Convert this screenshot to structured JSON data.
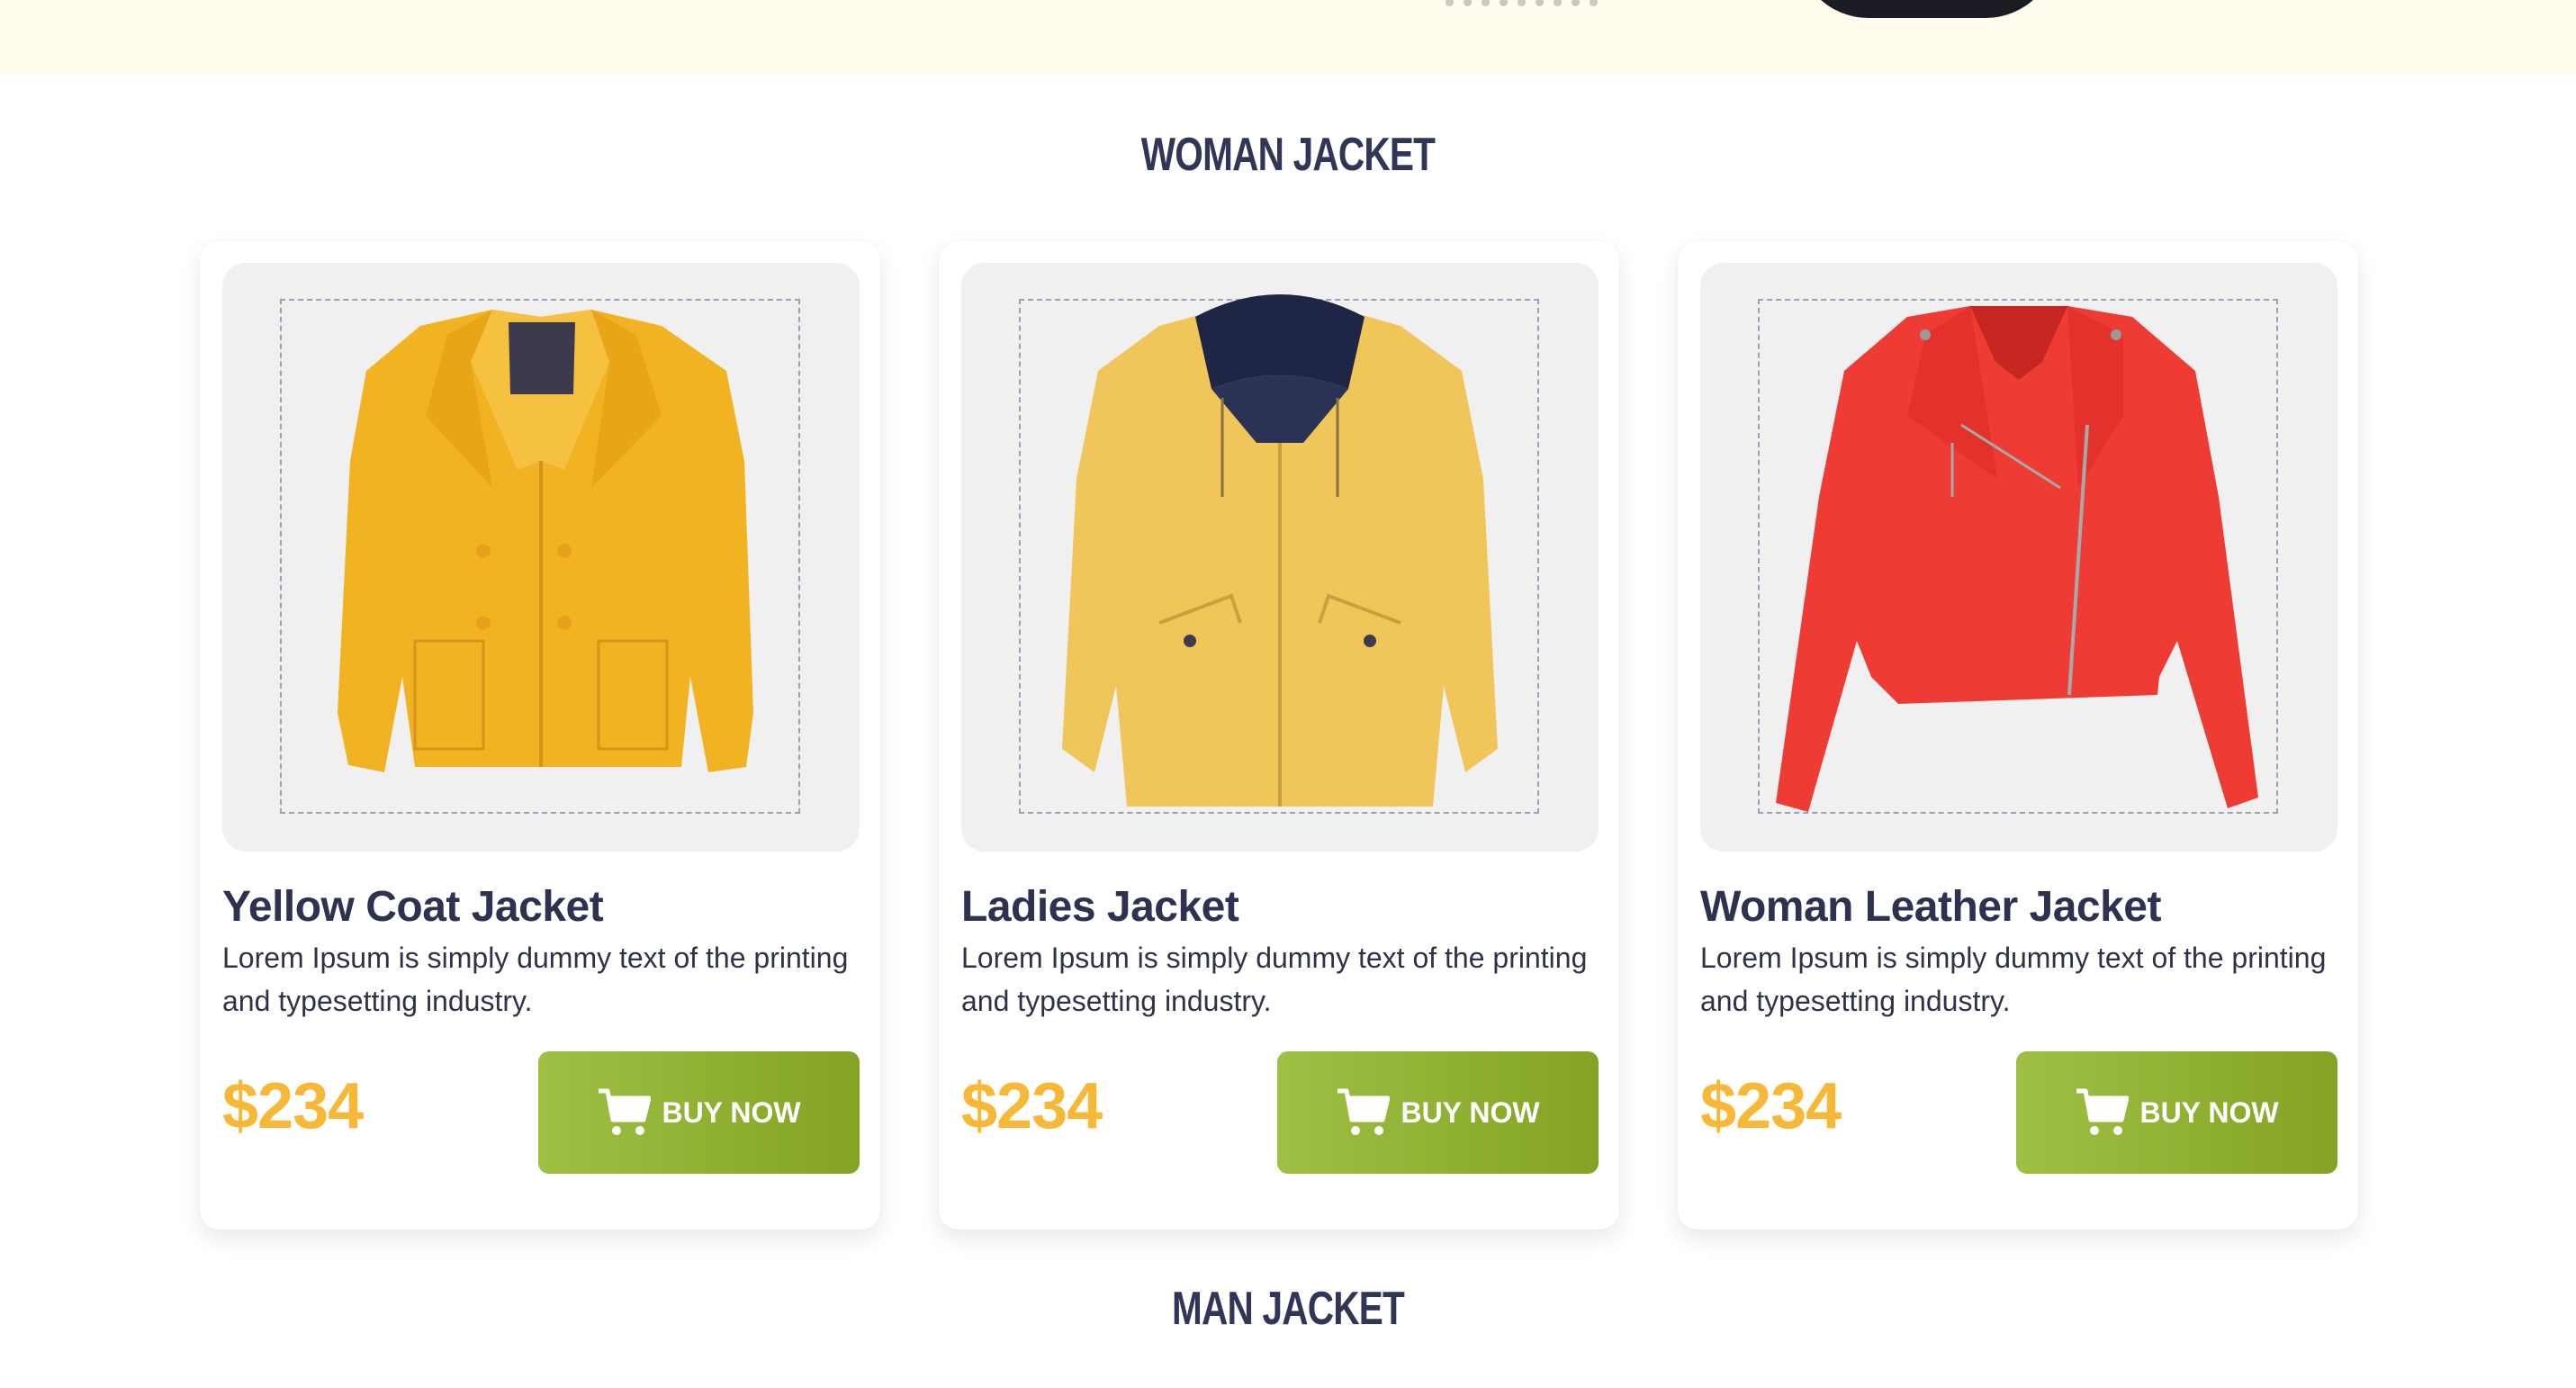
{
  "hero": {},
  "sections": {
    "woman_title": "WOMAN JACKET",
    "man_title": "MAN JACKET"
  },
  "products": [
    {
      "title": "Yellow Coat Jacket",
      "description": "Lorem Ipsum is simply dummy text of the printing and typesetting industry.",
      "price": "$234",
      "button": "BUY NOW",
      "image_icon": "yellow-coat-jacket-image"
    },
    {
      "title": "Ladies Jacket",
      "description": "Lorem Ipsum is simply dummy text of the printing and typesetting industry.",
      "price": "$234",
      "button": "BUY NOW",
      "image_icon": "ladies-jacket-image"
    },
    {
      "title": "Woman Leather Jacket",
      "description": "Lorem Ipsum is simply dummy text of the printing and typesetting industry.",
      "price": "$234",
      "button": "BUY NOW",
      "image_icon": "woman-leather-jacket-image"
    }
  ],
  "colors": {
    "hero_background": "#fffbed",
    "title": "#323656",
    "price": "#f7b838",
    "button_start": "#9fc044",
    "button_end": "#84a324",
    "jacket_mustard": "#f2b323",
    "jacket_yellow": "#f0c65b",
    "jacket_red": "#ee3c35"
  }
}
